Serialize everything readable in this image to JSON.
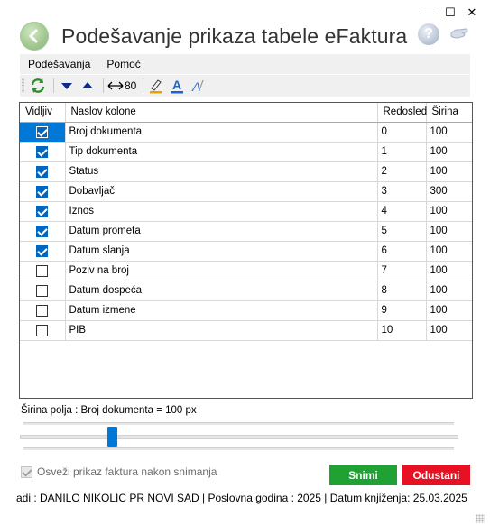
{
  "window": {
    "minimize": "—",
    "maximize": "☐",
    "close": "✕"
  },
  "header": {
    "title": "Podešavanje prikaza tabele eFaktura",
    "help_symbol": "?"
  },
  "menu": {
    "items": [
      "Podešavanja",
      "Pomoć"
    ]
  },
  "toolbar": {
    "width_value": "80"
  },
  "table": {
    "columns": [
      "Vidljiv",
      "Naslov kolone",
      "Redosled",
      "Širina"
    ],
    "rows": [
      {
        "visible": true,
        "title": "Broj dokumenta",
        "order": "0",
        "width": "100",
        "selected": true
      },
      {
        "visible": true,
        "title": "Tip dokumenta",
        "order": "1",
        "width": "100"
      },
      {
        "visible": true,
        "title": "Status",
        "order": "2",
        "width": "100"
      },
      {
        "visible": true,
        "title": "Dobavljač",
        "order": "3",
        "width": "300"
      },
      {
        "visible": true,
        "title": "Iznos",
        "order": "4",
        "width": "100"
      },
      {
        "visible": true,
        "title": "Datum prometa",
        "order": "5",
        "width": "100"
      },
      {
        "visible": true,
        "title": "Datum slanja",
        "order": "6",
        "width": "100"
      },
      {
        "visible": false,
        "title": "Poziv na broj",
        "order": "7",
        "width": "100"
      },
      {
        "visible": false,
        "title": "Datum dospeća",
        "order": "8",
        "width": "100"
      },
      {
        "visible": false,
        "title": "Datum izmene",
        "order": "9",
        "width": "100"
      },
      {
        "visible": false,
        "title": "PIB",
        "order": "10",
        "width": "100"
      }
    ]
  },
  "width_label": "Širina polja : Broj dokumenta = 100 px",
  "slider": {
    "value_fraction": 0.2
  },
  "refresh_option": {
    "label": "Osveži prikaz faktura nakon snimanja",
    "checked": true
  },
  "buttons": {
    "save": "Snimi",
    "cancel": "Odustani"
  },
  "status": {
    "text": "adi : DANILO NIKOLIC PR NOVI SAD  |  Poslovna godina : 2025  |  Datum knjiženja: 25.03.2025"
  },
  "colors": {
    "accent": "#0078d7",
    "save": "#1fa133",
    "cancel": "#e81123"
  }
}
